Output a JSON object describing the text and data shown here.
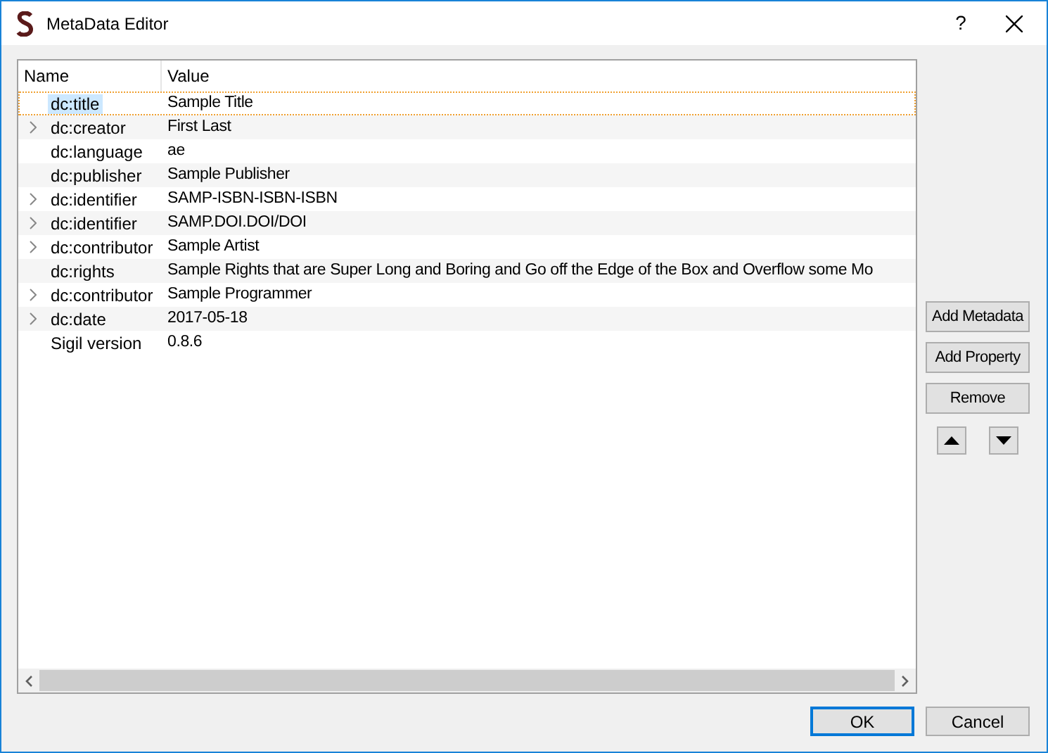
{
  "window": {
    "title": "MetaData Editor",
    "help": "?"
  },
  "table": {
    "columns": [
      "Name",
      "Value"
    ],
    "rows": [
      {
        "name": "dc:title",
        "value": "Sample Title",
        "expandable": false,
        "selected": true
      },
      {
        "name": "dc:creator",
        "value": "First Last",
        "expandable": true,
        "selected": false
      },
      {
        "name": "dc:language",
        "value": "ae",
        "expandable": false,
        "selected": false
      },
      {
        "name": "dc:publisher",
        "value": "Sample Publisher",
        "expandable": false,
        "selected": false
      },
      {
        "name": "dc:identifier",
        "value": "SAMP-ISBN-ISBN-ISBN",
        "expandable": true,
        "selected": false
      },
      {
        "name": "dc:identifier",
        "value": "SAMP.DOI.DOI/DOI",
        "expandable": true,
        "selected": false
      },
      {
        "name": "dc:contributor",
        "value": "Sample Artist",
        "expandable": true,
        "selected": false
      },
      {
        "name": "dc:rights",
        "value": "Sample Rights that are Super Long and Boring and Go off the Edge of the Box and Overflow some Mo",
        "expandable": false,
        "selected": false
      },
      {
        "name": "dc:contributor",
        "value": "Sample Programmer",
        "expandable": true,
        "selected": false
      },
      {
        "name": "dc:date",
        "value": "2017-05-18",
        "expandable": true,
        "selected": false
      },
      {
        "name": "Sigil version",
        "value": "0.8.6",
        "expandable": false,
        "selected": false
      }
    ]
  },
  "side_buttons": [
    "Add Metadata",
    "Add Property",
    "Remove"
  ],
  "buttons": [
    {
      "label": "OK",
      "default": true
    },
    {
      "label": "Cancel",
      "default": false
    }
  ]
}
